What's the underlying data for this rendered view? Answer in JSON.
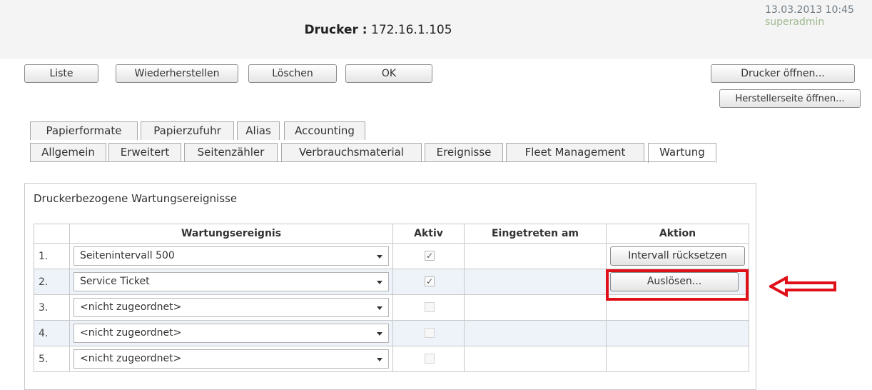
{
  "header": {
    "title_label": "Drucker :",
    "title_value": "172.16.1.105",
    "datetime": "13.03.2013 10:45",
    "user": "superadmin"
  },
  "toolbar": {
    "list": "Liste",
    "restore": "Wiederherstellen",
    "delete": "Löschen",
    "ok": "OK",
    "open_printer": "Drucker öffnen...",
    "open_vendor": "Herstellerseite öffnen..."
  },
  "tabs": {
    "row1": [
      "Papierformate",
      "Papierzufuhr",
      "Alias",
      "Accounting"
    ],
    "row2": [
      "Allgemein",
      "Erweitert",
      "Seitenzähler",
      "Verbrauchsmaterial",
      "Ereignisse",
      "Fleet Management",
      "Wartung"
    ],
    "active": "Wartung"
  },
  "panel": {
    "title": "Druckerbezogene Wartungsereignisse",
    "columns": [
      "Wartungsereignis",
      "Aktiv",
      "Eingetreten am",
      "Aktion"
    ],
    "rows": [
      {
        "num": "1.",
        "event": "Seitenintervall 500",
        "active": true,
        "enabled": true,
        "occurred": "",
        "action": "Intervall rücksetzen"
      },
      {
        "num": "2.",
        "event": "Service Ticket",
        "active": true,
        "enabled": true,
        "occurred": "",
        "action": "Auslösen..."
      },
      {
        "num": "3.",
        "event": "<nicht zugeordnet>",
        "active": false,
        "enabled": false,
        "occurred": "",
        "action": ""
      },
      {
        "num": "4.",
        "event": "<nicht zugeordnet>",
        "active": false,
        "enabled": false,
        "occurred": "",
        "action": ""
      },
      {
        "num": "5.",
        "event": "<nicht zugeordnet>",
        "active": false,
        "enabled": false,
        "occurred": "",
        "action": ""
      }
    ]
  },
  "colors": {
    "highlight": "#e0101a",
    "header_bg": "#f4f4f4",
    "row_alt": "#eef3f9"
  }
}
